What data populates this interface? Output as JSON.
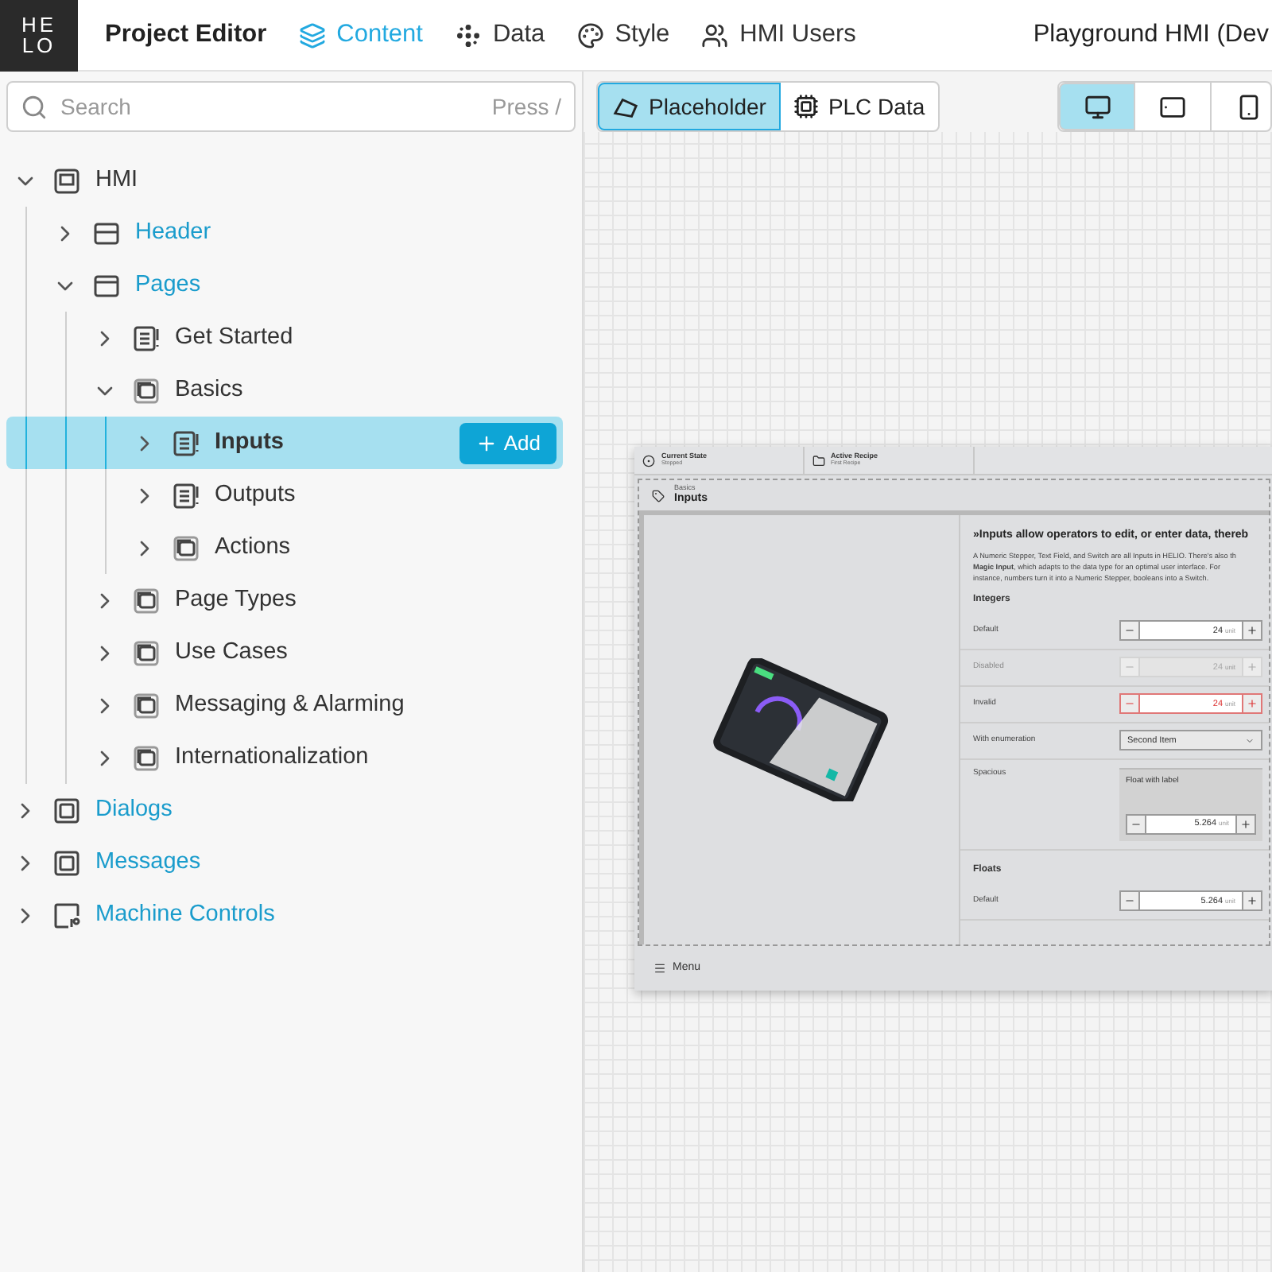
{
  "logo": {
    "lines": [
      "HE",
      "LO"
    ]
  },
  "app_title": "Project Editor",
  "nav": [
    {
      "label": "Content",
      "kind": "layers",
      "selected": true
    },
    {
      "label": "Data",
      "kind": "dots",
      "selected": false
    },
    {
      "label": "Style",
      "kind": "palette",
      "selected": false
    },
    {
      "label": "HMI Users",
      "kind": "users",
      "selected": false
    }
  ],
  "project_name": "Playground HMI (Dev",
  "search": {
    "placeholder": "Search",
    "shortcut": "Press /"
  },
  "tree": [
    {
      "label": "HMI",
      "kind": "hmi",
      "expanded": true,
      "selected": false,
      "children": [
        {
          "label": "Header",
          "kind": "header",
          "expanded": false,
          "selected": false
        },
        {
          "label": "Pages",
          "kind": "pages",
          "expanded": true,
          "selected": false,
          "children": [
            {
              "label": "Get Started",
              "kind": "page",
              "expanded": false,
              "selected": false
            },
            {
              "label": "Basics",
              "kind": "folder",
              "expanded": true,
              "selected": false,
              "children": [
                {
                  "label": "Inputs",
                  "kind": "page",
                  "expanded": false,
                  "selected": true
                },
                {
                  "label": "Outputs",
                  "kind": "page",
                  "expanded": false,
                  "selected": false
                },
                {
                  "label": "Actions",
                  "kind": "folder",
                  "expanded": false,
                  "selected": false
                }
              ]
            },
            {
              "label": "Page Types",
              "kind": "folder",
              "expanded": false,
              "selected": false
            },
            {
              "label": "Use Cases",
              "kind": "folder",
              "expanded": false,
              "selected": false
            },
            {
              "label": "Messaging & Alarming",
              "kind": "folder",
              "expanded": false,
              "selected": false
            },
            {
              "label": "Internationalization",
              "kind": "folder",
              "expanded": false,
              "selected": false
            }
          ]
        }
      ]
    },
    {
      "label": "Dialogs",
      "kind": "dialogs",
      "expanded": false,
      "selected": false
    },
    {
      "label": "Messages",
      "kind": "dialogs",
      "expanded": false,
      "selected": false
    },
    {
      "label": "Machine Controls",
      "kind": "controls",
      "expanded": false,
      "selected": false
    }
  ],
  "add_button": "Add",
  "view_toggle": [
    {
      "label": "Placeholder",
      "kind": "placeholder",
      "selected": true
    },
    {
      "label": "PLC Data",
      "kind": "chip",
      "selected": false
    }
  ],
  "devices": [
    {
      "kind": "desktop",
      "selected": true
    },
    {
      "kind": "tablet",
      "selected": false
    },
    {
      "kind": "phone",
      "selected": false
    }
  ],
  "preview": {
    "status": [
      {
        "label": "Current State",
        "value": "Stopped",
        "kind": "state"
      },
      {
        "label": "Active Recipe",
        "value": "First Recipe",
        "kind": "folder"
      }
    ],
    "breadcrumb": "Basics",
    "page_title": "Inputs",
    "heading": "»Inputs allow operators to edit, or enter data, thereb",
    "intro": "A Numeric Stepper, Text Field, and Switch are all Inputs in HELIO. There's also th **Magic Input**, which adapts to the data type for an optimal user interface. For instance, numbers turn it into a Numeric Stepper, booleans into a Switch.",
    "sections": [
      {
        "title": "Integers",
        "rows": [
          {
            "label": "Default",
            "kind": "stepper",
            "value": "24",
            "unit": "unit",
            "disabled": false,
            "invalid": false
          },
          {
            "label": "Disabled",
            "kind": "stepper",
            "value": "24",
            "unit": "unit",
            "disabled": true,
            "invalid": false
          },
          {
            "label": "Invalid",
            "kind": "stepper",
            "value": "24",
            "unit": "unit",
            "disabled": false,
            "invalid": true
          },
          {
            "label": "With enumeration",
            "kind": "select",
            "value": "Second Item"
          },
          {
            "label": "Spacious",
            "kind": "spacious",
            "caption": "Float with label",
            "value": "5.264",
            "unit": "unit",
            "disabled": false,
            "invalid": false
          }
        ]
      },
      {
        "title": "Floats",
        "rows": [
          {
            "label": "Default",
            "kind": "stepper",
            "value": "5.264",
            "unit": "unit",
            "disabled": false,
            "invalid": false
          }
        ]
      }
    ],
    "menu": "Menu"
  }
}
